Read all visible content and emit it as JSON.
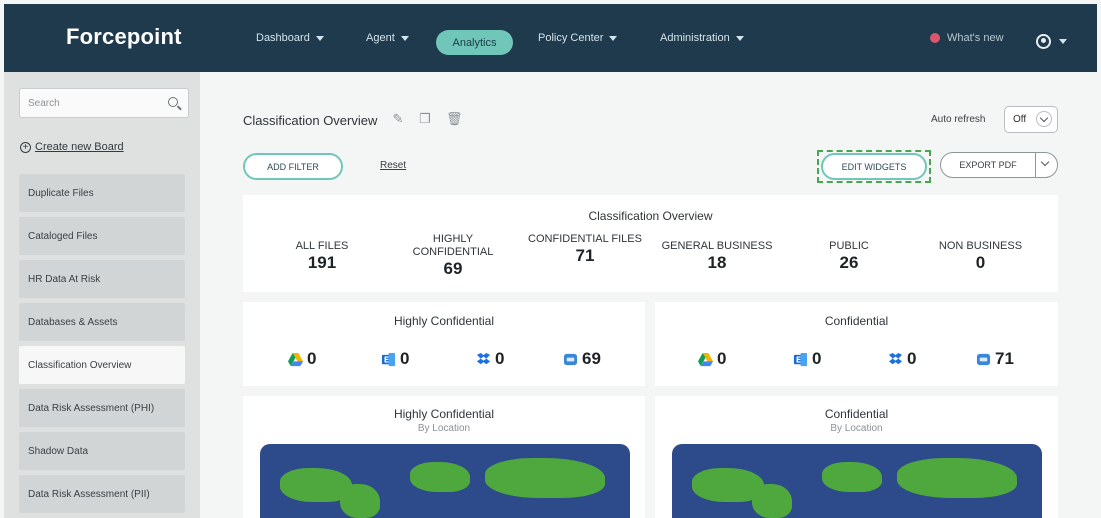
{
  "brand": {
    "logo": "Forcepoint"
  },
  "nav": {
    "items": [
      {
        "label": "Dashboard"
      },
      {
        "label": "Agent"
      },
      {
        "label": "Analytics"
      },
      {
        "label": "Policy Center"
      },
      {
        "label": "Administration"
      }
    ],
    "whats_new": "What's new"
  },
  "sidebar": {
    "search_placeholder": "Search",
    "create_board": "Create new Board",
    "boards": [
      {
        "label": "Duplicate Files"
      },
      {
        "label": "Cataloged Files"
      },
      {
        "label": "HR Data At Risk"
      },
      {
        "label": "Databases & Assets"
      },
      {
        "label": "Classification Overview"
      },
      {
        "label": "Data Risk Assessment (PHI)"
      },
      {
        "label": "Shadow Data"
      },
      {
        "label": "Data Risk Assessment (PII)"
      }
    ]
  },
  "toolbar": {
    "board_title": "Classification Overview",
    "auto_refresh_label": "Auto refresh",
    "auto_refresh_value": "Off",
    "add_filter": "ADD FILTER",
    "reset": "Reset",
    "edit_widgets": "EDIT WIDGETS",
    "export_pdf": "EXPORT PDF"
  },
  "overview": {
    "title": "Classification Overview",
    "stats": [
      {
        "label": "ALL FILES",
        "value": "191"
      },
      {
        "label": "HIGHLY CONFIDENTIAL",
        "value": "69"
      },
      {
        "label": "CONFIDENTIAL FILES",
        "value": "71"
      },
      {
        "label": "GENERAL BUSINESS",
        "value": "18"
      },
      {
        "label": "PUBLIC",
        "value": "26"
      },
      {
        "label": "NON BUSINESS",
        "value": "0"
      }
    ]
  },
  "highly_confidential": {
    "title": "Highly Confidential",
    "sources": {
      "gdrive": "0",
      "exchange": "0",
      "dropbox": "0",
      "sharepoint": "69"
    }
  },
  "confidential": {
    "title": "Confidential",
    "sources": {
      "gdrive": "0",
      "exchange": "0",
      "dropbox": "0",
      "sharepoint": "71"
    }
  },
  "location_maps": {
    "left": {
      "title": "Highly Confidential",
      "subtitle": "By Location"
    },
    "right": {
      "title": "Confidential",
      "subtitle": "By Location"
    }
  }
}
